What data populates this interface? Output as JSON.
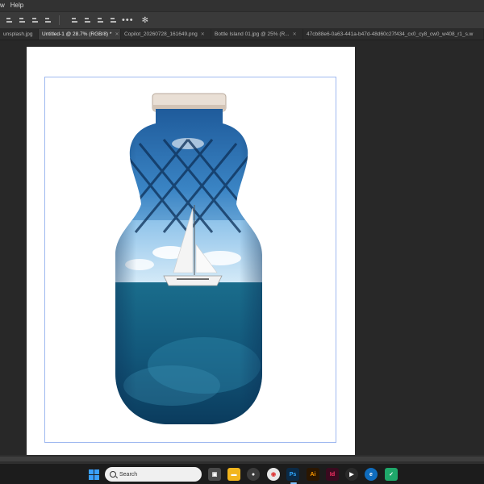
{
  "menubar": {
    "items": [
      "w",
      "Help"
    ]
  },
  "tabs": [
    {
      "label": "unsplash.jpg",
      "active": false
    },
    {
      "label": "Untitled-1 @ 28.7% (RGB/8) *",
      "active": true
    },
    {
      "label": "Copilot_20260728_161649.png",
      "active": false
    },
    {
      "label": "Bottle Island 01.jpg @ 25% (R...",
      "active": false
    },
    {
      "label": "47cb88e6-0a63-441a-b47d-48d60c27f434_cx0_cy8_cw0_w408_r1_s.w",
      "active": false
    }
  ],
  "taskbar": {
    "search_label": "Search"
  },
  "colors": {
    "bg": "#282828",
    "canvas": "#ffffff",
    "artboard_border": "#9fb9f0",
    "accent": "#3aa0ff"
  },
  "icons": [
    "align-left-icon",
    "align-center-icon",
    "align-right-icon",
    "more-icon",
    "settings-icon",
    "windows-start-icon",
    "search-icon"
  ]
}
